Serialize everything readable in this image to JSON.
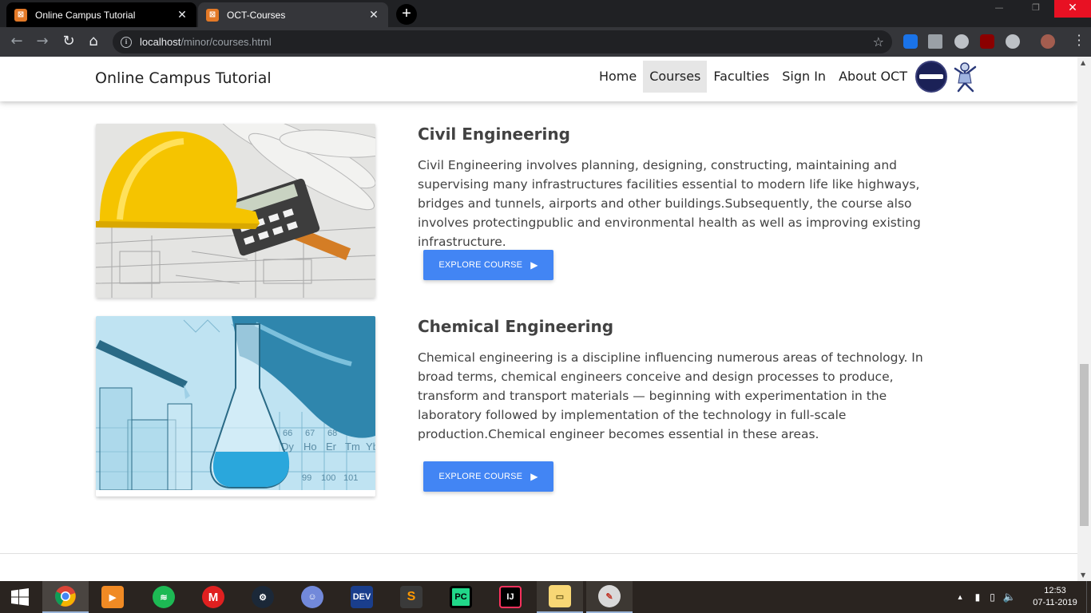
{
  "browser": {
    "tabs": [
      {
        "title": "Online Campus Tutorial",
        "active": true
      },
      {
        "title": "OCT-Courses",
        "active": false
      }
    ],
    "url_host": "localhost",
    "url_path": "/minor/courses.html",
    "window_controls": {
      "close": "✕"
    }
  },
  "site": {
    "brand": "Online Campus Tutorial",
    "nav": [
      {
        "label": "Home"
      },
      {
        "label": "Courses",
        "active": true
      },
      {
        "label": "Faculties"
      },
      {
        "label": "Sign In"
      },
      {
        "label": "About OCT"
      }
    ]
  },
  "courses": [
    {
      "title": "Civil Engineering",
      "description": "Civil Engineering involves planning, designing, constructing, maintaining and supervising many infrastructures facilities essential to modern life like highways, bridges and tunnels, airports and other buildings.Subsequently, the course also involves protectingpublic and environmental health as well as improving existing infrastructure.",
      "button_label": "EXPLORE COURSE",
      "image": "hard-hat-blueprints-calculator"
    },
    {
      "title": "Chemical Engineering",
      "description": "Chemical engineering is a discipline influencing numerous areas of technology. In broad terms, chemical engineers conceive and design processes to produce, transform and transport materials — beginning with experimentation in the laboratory followed by implementation of the technology in full-scale production.Chemical engineer becomes essential in these areas.",
      "button_label": "EXPLORE COURSE",
      "image": "lab-glassware-glove-periodic-table",
      "image_text": {
        "elements": [
          "Dy",
          "Ho",
          "Er",
          "Tm",
          "Yb"
        ],
        "numbers": [
          "66",
          "67",
          "68",
          "65",
          "99",
          "100",
          "101"
        ]
      }
    }
  ],
  "taskbar": {
    "apps": [
      "chrome",
      "media-player",
      "spotify",
      "mail",
      "steam",
      "discord",
      "dev-cpp",
      "sublime",
      "pycharm",
      "intellij",
      "file-explorer",
      "paint"
    ],
    "labels": {
      "dev": "DEV",
      "pycharm": "PC",
      "intellij": "IJ"
    },
    "time": "12:53",
    "date": "07-11-2019"
  },
  "colors": {
    "accent_button": "#4285f4",
    "title_text": "#424242",
    "tab_favicon": "#e37927"
  }
}
